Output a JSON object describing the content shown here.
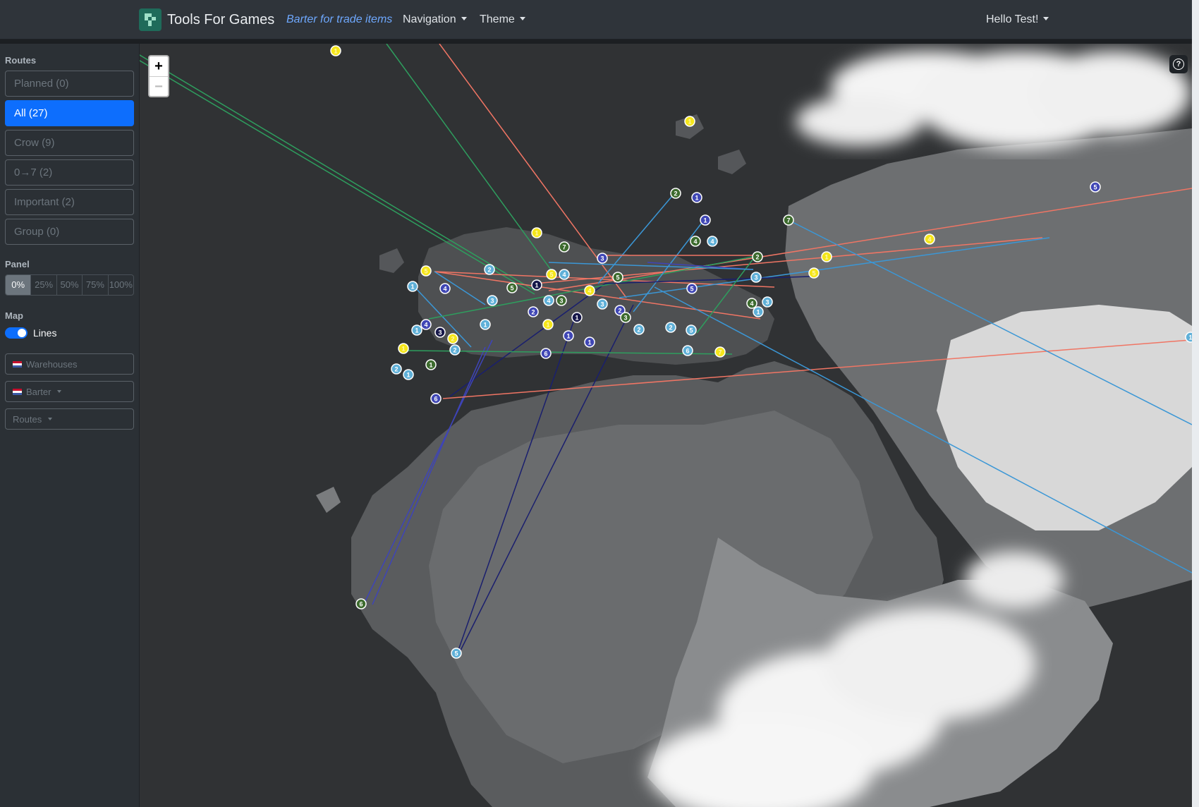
{
  "navbar": {
    "brand": "Tools For Games",
    "active_link": "Barter for trade items",
    "navigation": "Navigation",
    "theme": "Theme",
    "user": "Hello Test!"
  },
  "sidebar": {
    "routes_label": "Routes",
    "route_buttons": [
      "Planned (0)",
      "All (27)",
      "Crow (9)",
      "0→7 (2)",
      "Important (2)",
      "Group (0)"
    ],
    "selected_route": "All (27)",
    "panel_label": "Panel",
    "panel_options": [
      "0%",
      "25%",
      "50%",
      "75%",
      "100%"
    ],
    "selected_panel": "0%",
    "map_label": "Map",
    "lines_label": "Lines",
    "lines_enabled": true,
    "warehouses": "Warehouses",
    "barter": "Barter",
    "routes_select": "Routes"
  },
  "map": {
    "zoom_in": "+",
    "zoom_out": "−",
    "help": "?",
    "colors": {
      "route_red": "#f07564",
      "route_green": "#2e9e5e",
      "route_blue": "#3b97d6",
      "route_navy": "#1a1f6e",
      "route_indigo": "#3e44b8",
      "marker_yellow": "#f5e61a",
      "marker_lightblue": "#5fb0d8",
      "marker_green": "#3d6b2e",
      "marker_indigo": "#4047b5",
      "marker_navy": "#17184a"
    },
    "marker_labels": [
      "1",
      "2",
      "3",
      "4",
      "5",
      "6",
      "7"
    ]
  }
}
